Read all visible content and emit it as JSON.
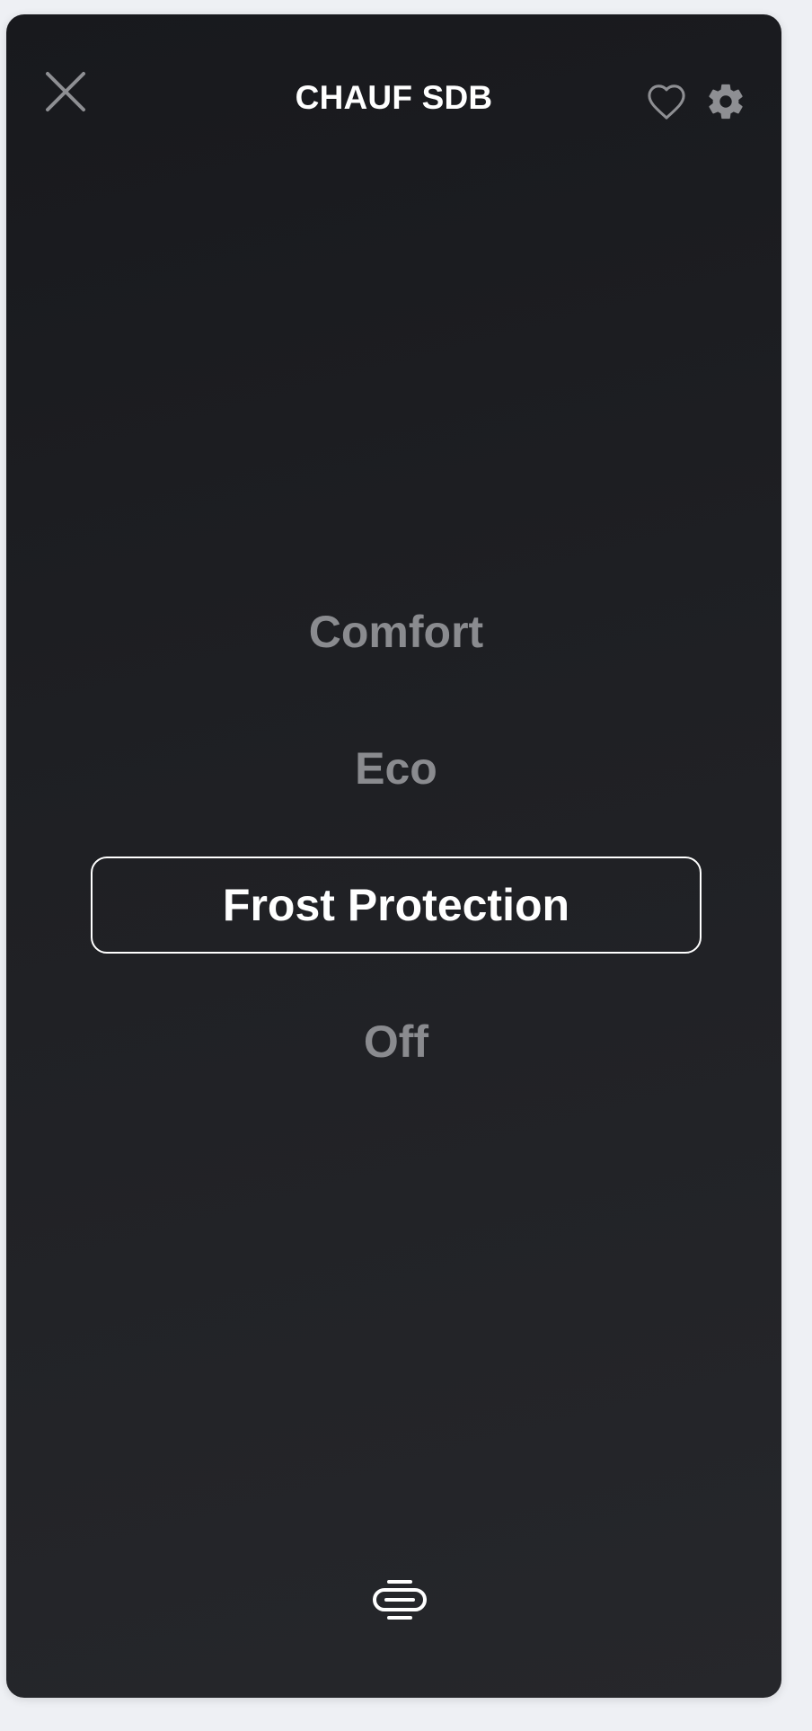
{
  "header": {
    "title": "CHAUF SDB",
    "close_icon": "close-icon",
    "favorite_icon": "heart-outline-icon",
    "settings_icon": "gear-icon"
  },
  "modes": [
    {
      "label": "Comfort",
      "selected": false
    },
    {
      "label": "Eco",
      "selected": false
    },
    {
      "label": "Frost Protection",
      "selected": true
    },
    {
      "label": "Off",
      "selected": false
    }
  ],
  "footer": {
    "icon": "stacked-lines-icon"
  },
  "colors": {
    "panel_background": "#1d1e22",
    "selected_text": "#ffffff",
    "unselected_text": "#8a8b8f",
    "icon_gray": "#8e8f93"
  }
}
